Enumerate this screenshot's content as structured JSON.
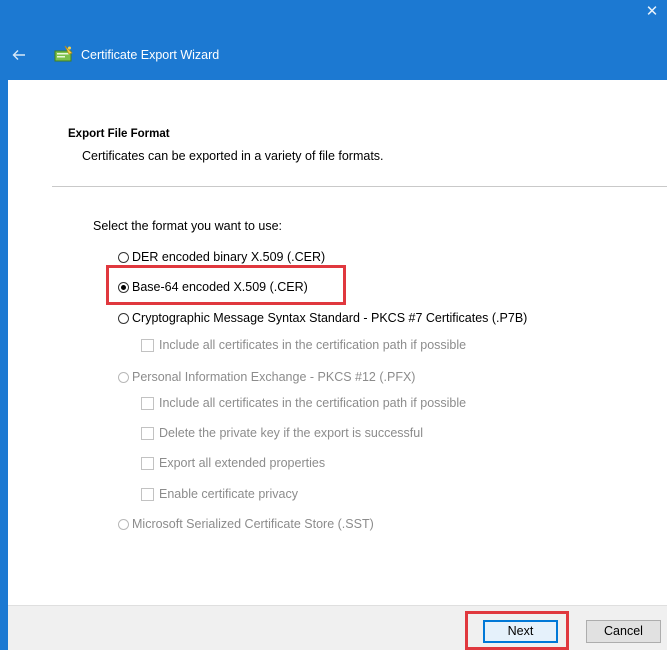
{
  "window": {
    "close_glyph": "✕",
    "title": "Certificate Export Wizard",
    "icons": {
      "back": "arrow-left-icon",
      "wizard": "certificate-wizard-icon",
      "close": "close-icon"
    },
    "colors": {
      "titlebar": "#1c79d2",
      "highlight": "#e0383e",
      "default_button_border": "#0078d7"
    }
  },
  "page": {
    "section_title": "Export File Format",
    "section_desc": "Certificates can be exported in a variety of file formats.",
    "select_label": "Select the format you want to use:",
    "options": [
      {
        "label": "DER encoded binary X.509 (.CER)",
        "checked": false,
        "enabled": true
      },
      {
        "label": "Base-64 encoded X.509 (.CER)",
        "checked": true,
        "enabled": true
      },
      {
        "label": "Cryptographic Message Syntax Standard - PKCS #7 Certificates (.P7B)",
        "checked": false,
        "enabled": true
      },
      {
        "label": "Personal Information Exchange - PKCS #12 (.PFX)",
        "checked": false,
        "enabled": false
      },
      {
        "label": "Microsoft Serialized Certificate Store (.SST)",
        "checked": false,
        "enabled": false
      }
    ],
    "p7b_checkbox": "Include all certificates in the certification path if possible",
    "pfx_checkboxes": [
      "Include all certificates in the certification path if possible",
      "Delete the private key if the export is successful",
      "Export all extended properties",
      "Enable certificate privacy"
    ]
  },
  "footer": {
    "next_label": "Next",
    "cancel_label": "Cancel"
  }
}
